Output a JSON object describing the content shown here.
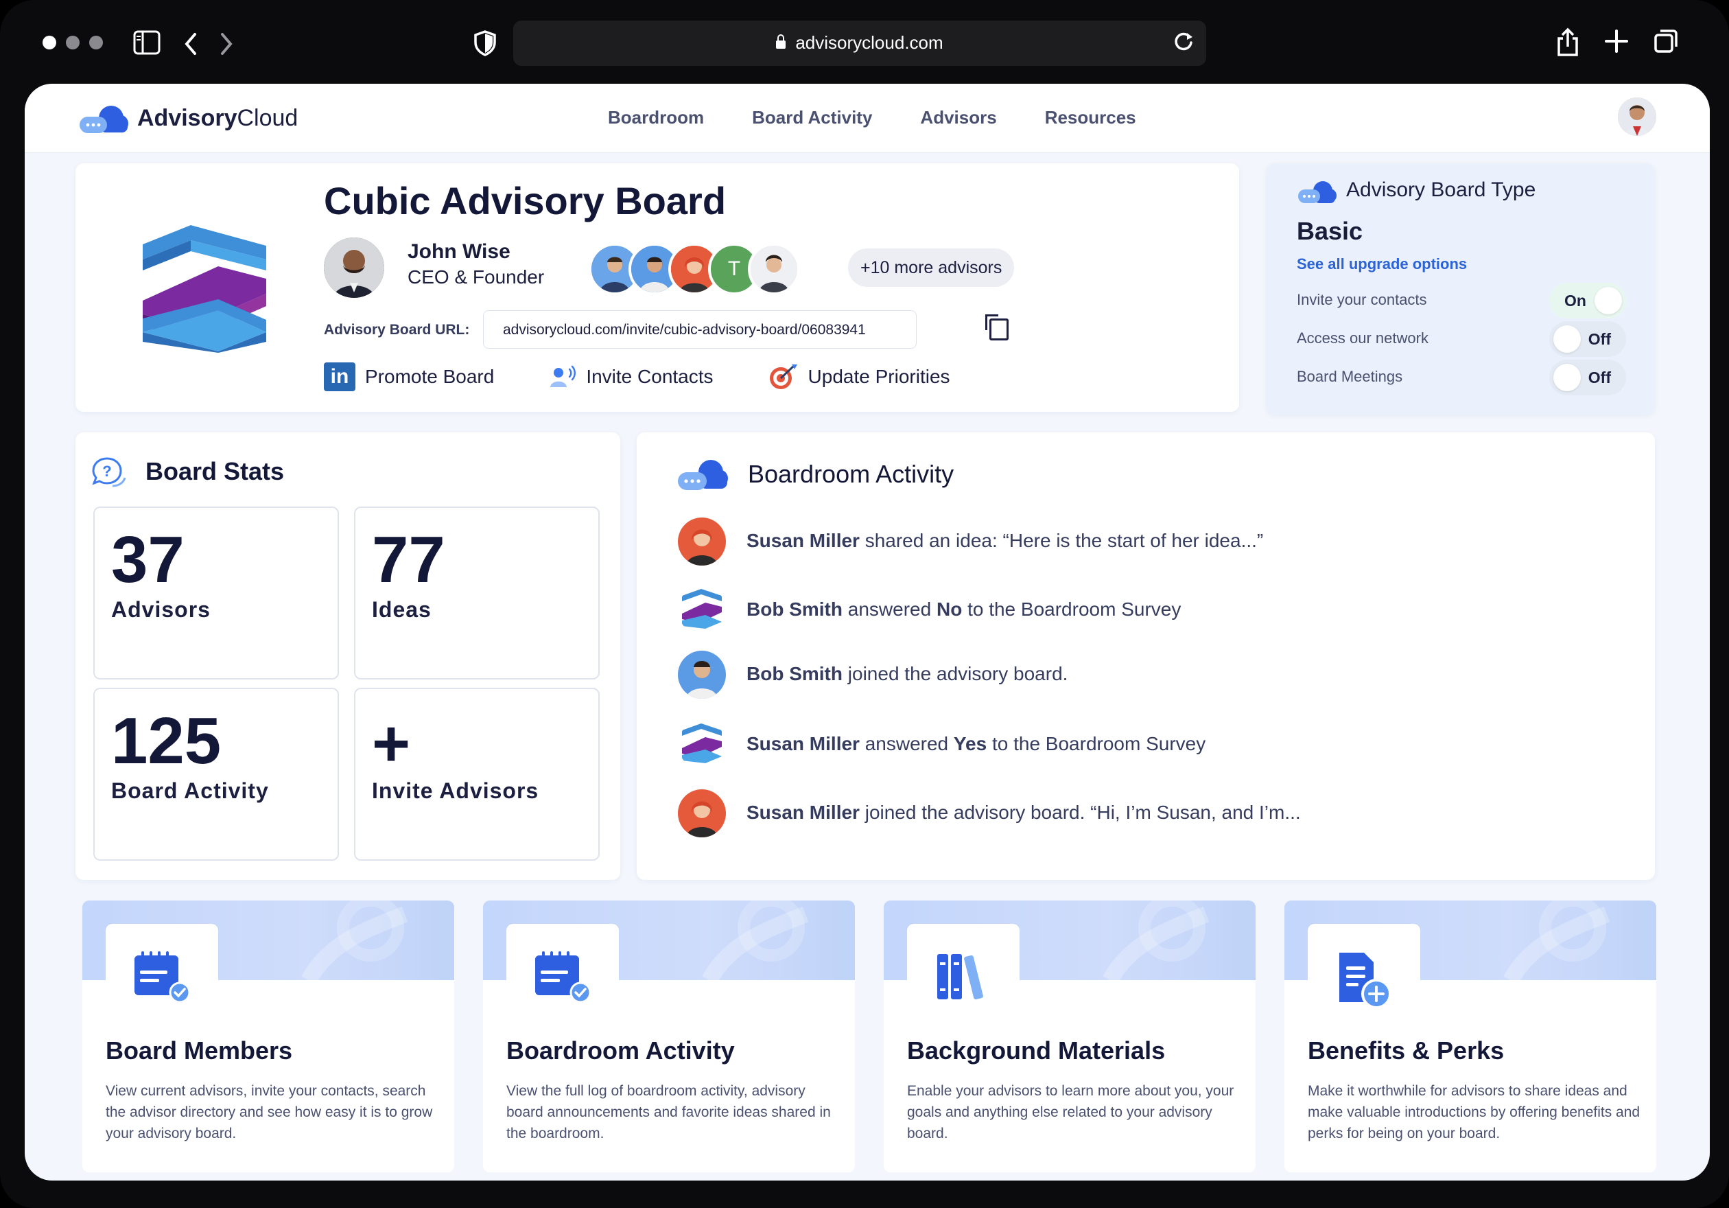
{
  "browser": {
    "url": "advisorycloud.com"
  },
  "nav": {
    "logo_bold": "Advisory",
    "logo_light": "Cloud",
    "links": [
      "Boardroom",
      "Board Activity",
      "Advisors",
      "Resources"
    ]
  },
  "board": {
    "title": "Cubic Advisory Board",
    "owner_name": "John Wise",
    "owner_role": "CEO & Founder",
    "advisor_initial": "T",
    "more_advisors": "+10 more advisors",
    "url_label": "Advisory Board URL:",
    "url_value": "advisorycloud.com/invite/cubic-advisory-board/06083941",
    "actions": [
      "Promote Board",
      "Invite Contacts",
      "Update Priorities"
    ]
  },
  "board_type": {
    "heading": "Advisory Board Type",
    "value": "Basic",
    "upgrade_link": "See all upgrade options",
    "toggles": [
      {
        "label": "Invite your contacts",
        "state": "On"
      },
      {
        "label": "Access our network",
        "state": "Off"
      },
      {
        "label": "Board Meetings",
        "state": "Off"
      }
    ]
  },
  "stats": {
    "title": "Board Stats",
    "tiles": [
      {
        "number": "37",
        "label": "Advisors"
      },
      {
        "number": "77",
        "label": "Ideas"
      },
      {
        "number": "125",
        "label": "Board Activity"
      },
      {
        "number": "+",
        "label": "Invite Advisors"
      }
    ]
  },
  "activity": {
    "title": "Boardroom Activity",
    "items": [
      {
        "name": "Susan Miller",
        "pre": " shared an idea: “Here is the start of her idea...”",
        "bold2": "",
        "post": "",
        "avatar": "susan"
      },
      {
        "name": "Bob Smith",
        "pre": " answered ",
        "bold2": "No",
        "post": " to the Boardroom Survey",
        "avatar": "cube"
      },
      {
        "name": "Bob Smith",
        "pre": " joined the advisory board.",
        "bold2": "",
        "post": "",
        "avatar": "bob"
      },
      {
        "name": "Susan Miller",
        "pre": " answered ",
        "bold2": "Yes",
        "post": " to the Boardroom Survey",
        "avatar": "cube"
      },
      {
        "name": "Susan Miller",
        "pre": " joined the advisory board. “Hi, I’m Susan, and I’m...",
        "bold2": "",
        "post": "",
        "avatar": "susan"
      }
    ]
  },
  "features": [
    {
      "title": "Board Members",
      "desc": "View current advisors, invite your contacts, search the advisor directory and see how easy it is to grow your advisory board.",
      "icon": "calendar-check-icon"
    },
    {
      "title": "Boardroom Activity",
      "desc": "View the full log of boardroom activity, advisory board announcements and favorite ideas shared in the boardroom.",
      "icon": "calendar-check-icon"
    },
    {
      "title": "Background Materials",
      "desc": "Enable your advisors to learn more about you, your goals and anything else related to your advisory board.",
      "icon": "books-icon"
    },
    {
      "title": "Benefits & Perks",
      "desc": "Make it worthwhile for advisors to share ideas and make valuable introductions by offering benefits and perks for being on your board.",
      "icon": "document-add-icon"
    }
  ],
  "colors": {
    "accent": "#2c63d6",
    "brand_blue": "#3d7bf0",
    "brand_purple": "#7b2aa0",
    "toggle_on": "#e7f6ef"
  }
}
